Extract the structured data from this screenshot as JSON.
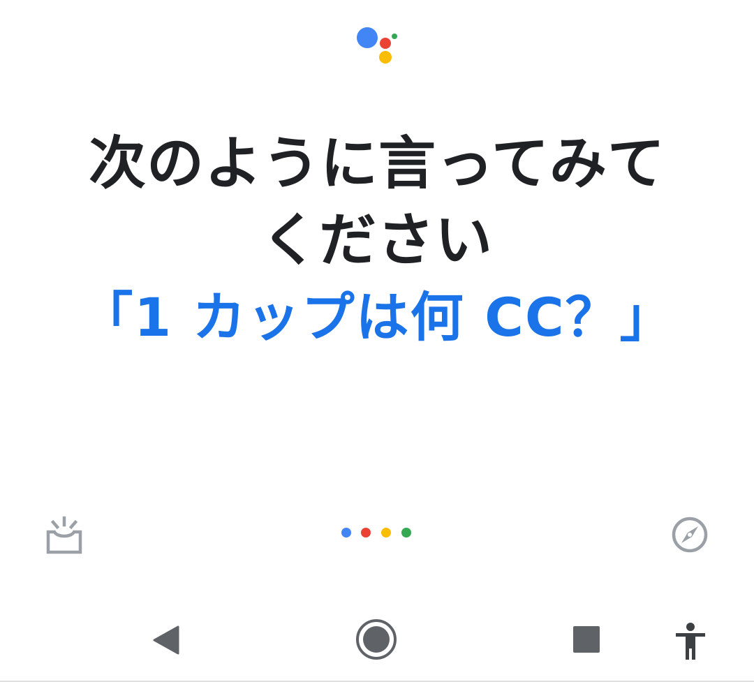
{
  "prompt": {
    "line1": "次のように言ってみて",
    "line2": "ください",
    "suggestion": "「1 カップは何 CC？」"
  },
  "icons": {
    "logo": "google-assistant-logo",
    "updates": "updates-tray-icon",
    "explore": "compass-icon",
    "back": "back-triangle-icon",
    "home": "home-circle-icon",
    "recents": "recents-square-icon",
    "accessibility": "accessibility-person-icon"
  },
  "colors": {
    "blue": "#4285f4",
    "red": "#ea4335",
    "yellow": "#fbbc04",
    "green": "#34a853",
    "text": "#202124",
    "suggestion": "#1a73e8",
    "icon_gray": "#9aa0a6",
    "nav_gray": "#5f6368"
  }
}
